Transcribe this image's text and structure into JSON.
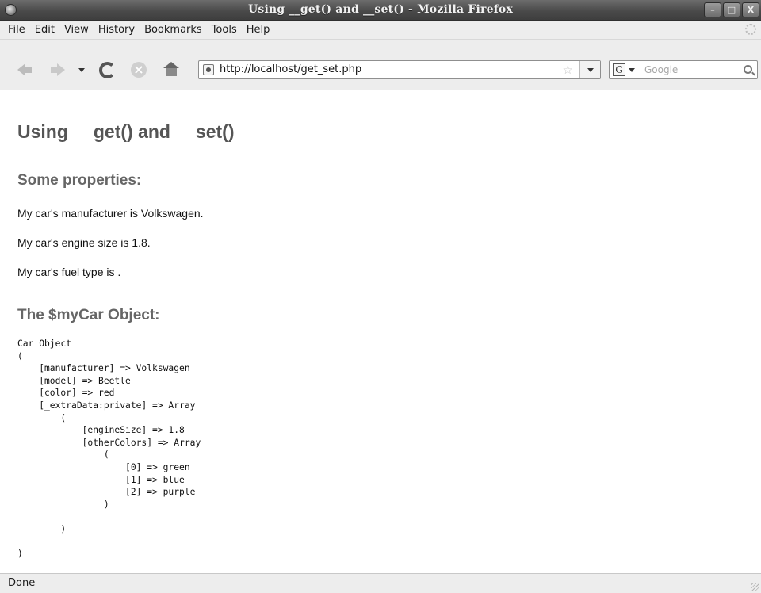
{
  "window": {
    "title": "Using __get() and __set() - Mozilla Firefox",
    "buttons": {
      "minimize": "–",
      "maximize": "□",
      "close": "X"
    }
  },
  "menu": [
    "File",
    "Edit",
    "View",
    "History",
    "Bookmarks",
    "Tools",
    "Help"
  ],
  "navigation": {
    "url": "http://localhost/get_set.php",
    "search_engine": "G",
    "search_placeholder": "Google"
  },
  "page": {
    "heading": "Using __get() and __set()",
    "properties_heading": "Some properties:",
    "lines": [
      "My car's manufacturer is Volkswagen.",
      "My car's engine size is 1.8.",
      "My car's fuel type is ."
    ],
    "object_heading": "The $myCar Object:",
    "object_dump": "Car Object\n(\n    [manufacturer] => Volkswagen\n    [model] => Beetle\n    [color] => red\n    [_extraData:private] => Array\n        (\n            [engineSize] => 1.8\n            [otherColors] => Array\n                (\n                    [0] => green\n                    [1] => blue\n                    [2] => purple\n                )\n\n        )\n\n)"
  },
  "status": "Done"
}
